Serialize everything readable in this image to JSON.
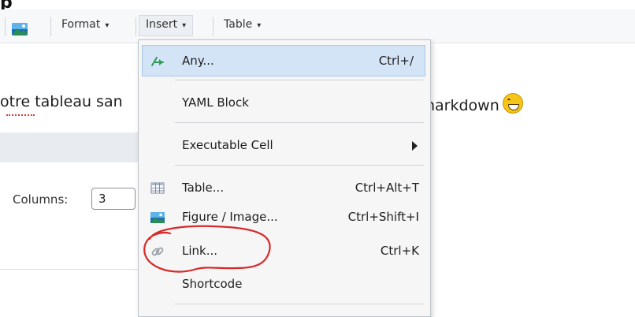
{
  "top_glyph": "p",
  "toolbar": {
    "format_label": "Format",
    "insert_label": "Insert",
    "table_label": "Table",
    "caret": "▾"
  },
  "document": {
    "text_left": "otre tableau san",
    "text_right": "narkdown"
  },
  "panel": {
    "columns_label": "Columns:",
    "columns_value": "3"
  },
  "menu": {
    "items": [
      {
        "label": "Any...",
        "shortcut": "Ctrl+/",
        "icon": "arrow-icon"
      },
      {
        "label": "YAML Block",
        "shortcut": ""
      },
      {
        "label": "Executable Cell",
        "shortcut": "",
        "submenu": true
      },
      {
        "label": "Table...",
        "shortcut": "Ctrl+Alt+T",
        "icon": "table-grid-icon"
      },
      {
        "label": "Figure / Image...",
        "shortcut": "Ctrl+Shift+I",
        "icon": "image-icon"
      },
      {
        "label": "Link...",
        "shortcut": "Ctrl+K",
        "icon": "link-icon"
      },
      {
        "label": "Shortcode",
        "shortcut": ""
      }
    ]
  },
  "colors": {
    "highlight": "#d3e4f6",
    "annotation": "#d62b2b",
    "accent_green": "#2e9c54"
  }
}
